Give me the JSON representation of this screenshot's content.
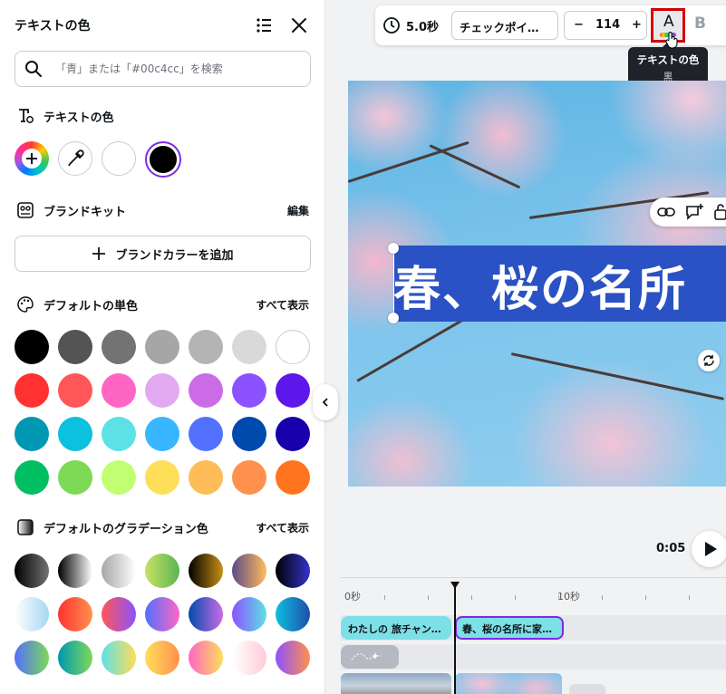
{
  "panel": {
    "title": "テキストの色",
    "search_placeholder": "「青」または「#00c4cc」を検索",
    "text_color_section": {
      "title": "テキストの色",
      "colors": [
        "#000000"
      ],
      "selected": "#000000"
    },
    "brand_kit": {
      "title": "ブランドキット",
      "edit_label": "編集",
      "add_label": "ブランドカラーを追加"
    },
    "default_solid": {
      "title": "デフォルトの単色",
      "show_all": "すべて表示",
      "colors": [
        "#000000",
        "#545454",
        "#737373",
        "#a6a6a6",
        "#b4b4b4",
        "#d9d9d9",
        "#ffffff",
        "#ff3131",
        "#ff5757",
        "#ff66c4",
        "#e2a9f1",
        "#cb6ce6",
        "#8c52ff",
        "#5e17eb",
        "#0097b2",
        "#0cc0df",
        "#5ce1e6",
        "#38b6ff",
        "#5271ff",
        "#004aad",
        "#1800ad",
        "#00bf63",
        "#7ed957",
        "#c1ff72",
        "#ffde59",
        "#ffbd59",
        "#ff914d",
        "#ff751f"
      ]
    },
    "default_gradient": {
      "title": "デフォルトのグラデーション色",
      "show_all": "すべて表示",
      "gradients": [
        [
          "#000000",
          "#737373"
        ],
        [
          "#000000",
          "#ffffff"
        ],
        [
          "#a6a6a6",
          "#ffffff"
        ],
        [
          "#c9e265",
          "#5ab552"
        ],
        [
          "#000000",
          "#c89116"
        ],
        [
          "#5d4a8a",
          "#ffbd59"
        ],
        [
          "#000000",
          "#3533cd"
        ],
        [
          "#ffffff",
          "#a5d7f3"
        ],
        [
          "#ff3131",
          "#ff914d"
        ],
        [
          "#ff5757",
          "#8c52ff"
        ],
        [
          "#5170ff",
          "#ff66c4"
        ],
        [
          "#004aad",
          "#cb6ce6"
        ],
        [
          "#8c52ff",
          "#5ce1e6"
        ],
        [
          "#0cc0df",
          "#1f4eaa"
        ],
        [
          "#5170ff",
          "#7ed957"
        ],
        [
          "#0097b2",
          "#7ed957"
        ],
        [
          "#5de0e6",
          "#ffde59"
        ],
        [
          "#ffde59",
          "#ff914d"
        ],
        [
          "#ff66c4",
          "#ffde59"
        ],
        [
          "#ffffff",
          "#ffcbd8"
        ],
        [
          "#8c52ff",
          "#ff914d"
        ]
      ]
    }
  },
  "toolbar": {
    "duration": "5.0秒",
    "font_name": "チェックポイ…",
    "font_size": "114",
    "color_letter": "A",
    "bold_letter": "B",
    "tooltip_title": "テキストの色",
    "tooltip_sub": "黒"
  },
  "canvas": {
    "title_text": "春、桜の名所"
  },
  "playback": {
    "time": "0:05"
  },
  "timeline": {
    "labels": [
      "0秒",
      "10秒"
    ],
    "clip1": "わたしの 旅チャン…",
    "clip2": "春、桜の名所に家…"
  },
  "colors": {
    "accent": "#7d2ae8",
    "highlight": "#d40000",
    "title_band": "#2a52c4",
    "clip": "#7de0e6"
  }
}
